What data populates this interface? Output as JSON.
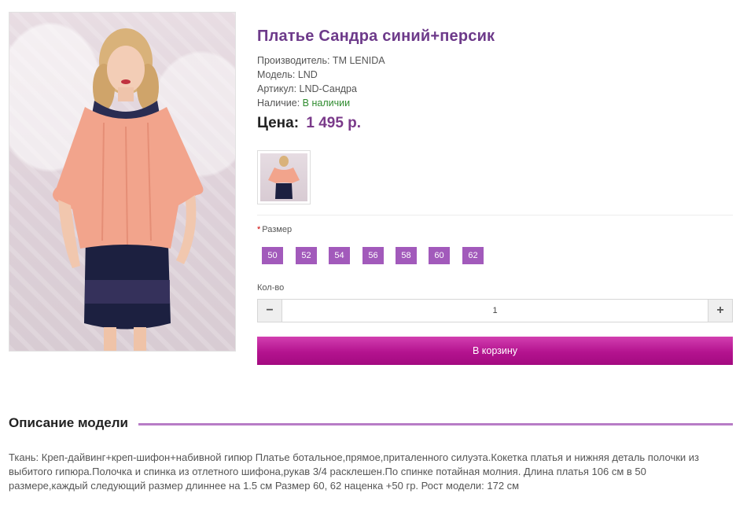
{
  "product": {
    "title": "Платье Сандра синий+персик",
    "manufacturer": "Производитель: ТМ LENIDA",
    "model": "Модель: LND",
    "article": "Артикул: LND-Сандра",
    "availability_label": "Наличие: ",
    "availability_value": "В наличии",
    "price_label": "Цена:",
    "price_value": "1 495 р."
  },
  "options": {
    "size_required_mark": "*",
    "size_label": "Размер",
    "sizes": [
      "50",
      "52",
      "54",
      "56",
      "58",
      "60",
      "62"
    ]
  },
  "quantity": {
    "label": "Кол-во",
    "minus_symbol": "−",
    "plus_symbol": "+",
    "value": "1"
  },
  "cart": {
    "button_label": "В корзину"
  },
  "description": {
    "heading": "Описание модели",
    "text": "Ткань: Креп-дайвинг+креп-шифон+набивной гипюр Платье ботальное,прямое,приталенного силуэта.Кокетка платья и нижняя деталь полочки из выбитого гипюра.Полочка и спинка из отлетного шифона,рукав 3/4 расклешен.По спинке потайная молния. Длина платья 106 см в 50 размере,каждый следующий размер длиннее на 1.5 см Размер 60, 62 наценка +50 гр. Рост модели: 172 см"
  },
  "colors": {
    "accent": "#a25abb",
    "title": "#6d3a8a",
    "button": "#b4138f",
    "peach": "#f2a48c",
    "navy": "#1a1f3d"
  }
}
